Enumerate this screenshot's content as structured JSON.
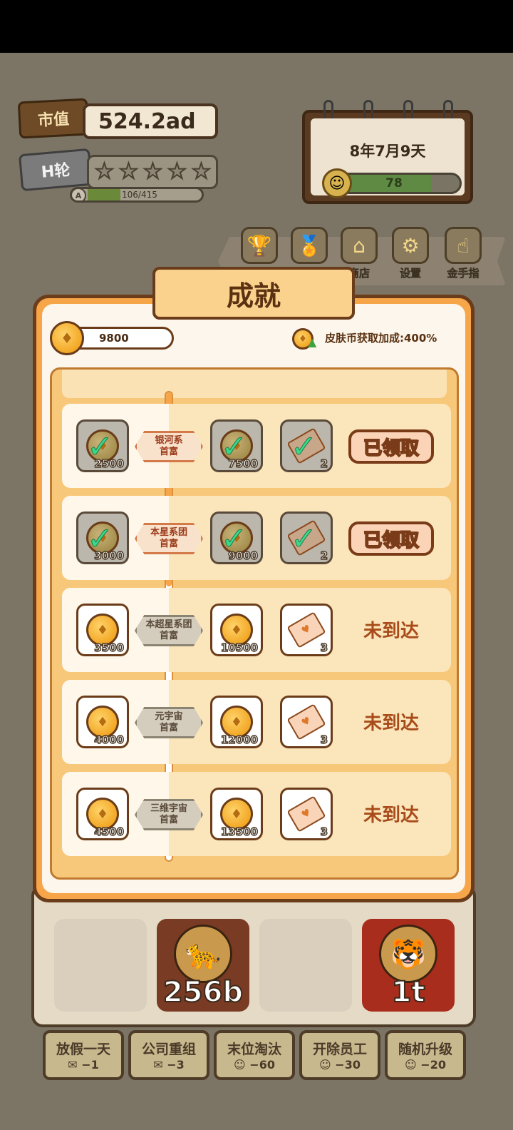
{
  "hud": {
    "market_value_label": "市值",
    "market_value": "524.2ad",
    "round_label": "H轮",
    "stars_total": 5,
    "stars_filled": 0,
    "exp_grade": "A",
    "exp_current": "106",
    "exp_sep": "/",
    "exp_max": "415",
    "exp_fraction": 0.255,
    "date": "8年7月9天",
    "mood_value": "78",
    "mood_fraction": 0.78
  },
  "menu": {
    "items": [
      {
        "label": "",
        "icon": "trophy-icon"
      },
      {
        "label": "",
        "icon": "medal-icon"
      },
      {
        "label": "商店",
        "icon": "shop-icon"
      },
      {
        "label": "设置",
        "icon": "gear-icon"
      },
      {
        "label": "金手指",
        "icon": "pointing-hand-icon"
      }
    ]
  },
  "modal": {
    "title": "成就",
    "coin_balance": "9800",
    "bonus_text": "皮肤币获取加成:400%",
    "claimed_label": "已领取",
    "not_reached_label": "未到达",
    "rows": [
      {
        "milestone": "银河系\n首富",
        "reward1": "2500",
        "reward2": "7500",
        "tickets": "2",
        "status": "claimed"
      },
      {
        "milestone": "本星系团\n首富",
        "reward1": "3000",
        "reward2": "9000",
        "tickets": "2",
        "status": "claimed"
      },
      {
        "milestone": "本超星系团\n首富",
        "reward1": "3500",
        "reward2": "10500",
        "tickets": "3",
        "status": "not_reached"
      },
      {
        "milestone": "元宇宙\n首富",
        "reward1": "4000",
        "reward2": "12000",
        "tickets": "3",
        "status": "not_reached"
      },
      {
        "milestone": "三维宇宙\n首富",
        "reward1": "4500",
        "reward2": "13500",
        "tickets": "3",
        "status": "not_reached"
      }
    ]
  },
  "grid": {
    "cells": [
      {
        "type": "empty",
        "value": ""
      },
      {
        "type": "jaguar",
        "value": "256b"
      },
      {
        "type": "empty",
        "value": ""
      },
      {
        "type": "tiger",
        "value": "1t"
      }
    ]
  },
  "actions": [
    {
      "label": "放假一天",
      "cost": "−1",
      "cost_icon": "ticket-icon"
    },
    {
      "label": "公司重组",
      "cost": "−3",
      "cost_icon": "ticket-icon"
    },
    {
      "label": "末位淘汰",
      "cost": "−60",
      "cost_icon": "smiley-icon"
    },
    {
      "label": "开除员工",
      "cost": "−30",
      "cost_icon": "smiley-icon"
    },
    {
      "label": "随机升级",
      "cost": "−20",
      "cost_icon": "smiley-icon"
    }
  ],
  "colors": {
    "modal_orange": "#f7a549",
    "brown": "#6b3c19",
    "check_green": "#3bd98a"
  }
}
